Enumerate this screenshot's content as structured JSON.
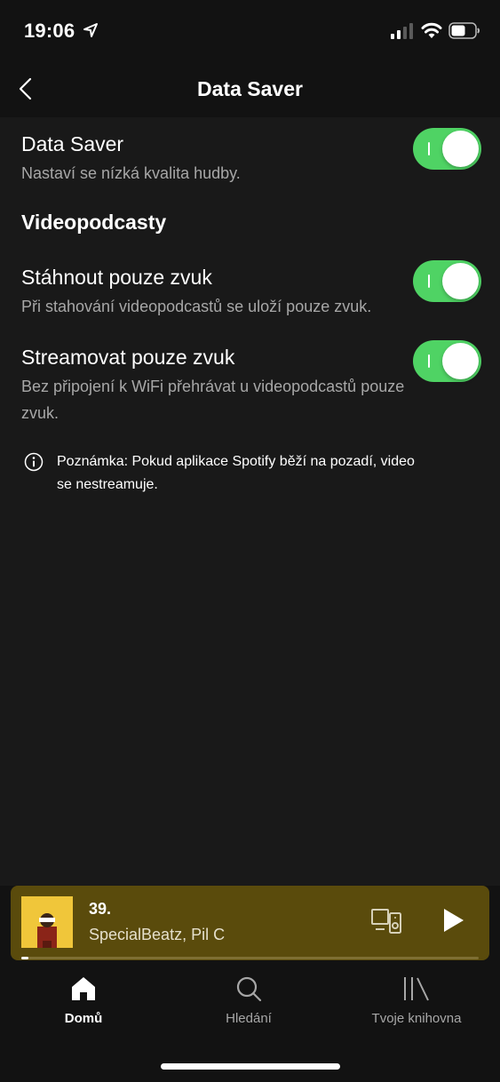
{
  "status_bar": {
    "time": "19:06"
  },
  "nav": {
    "title": "Data Saver"
  },
  "settings": {
    "data_saver": {
      "title": "Data Saver",
      "description": "Nastaví se nízká kvalita hudby.",
      "enabled": true
    },
    "section_heading": "Videopodcasty",
    "audio_only_download": {
      "title": "Stáhnout pouze zvuk",
      "description": "Při stahování videopodcastů se uloží pouze zvuk.",
      "enabled": true
    },
    "audio_only_stream": {
      "title": "Streamovat pouze zvuk",
      "description": "Bez připojení k WiFi přehrávat u videopodcastů pouze zvuk.",
      "enabled": true
    },
    "note": "Poznámka: Pokud aplikace Spotify běží na pozadí, video se nestreamuje."
  },
  "player": {
    "title": "39.",
    "artist": "SpecialBeatz, Pil C",
    "progress": 0.015
  },
  "tabs": [
    {
      "label": "Domů",
      "icon": "home-icon",
      "active": true
    },
    {
      "label": "Hledání",
      "icon": "search-icon",
      "active": false
    },
    {
      "label": "Tvoje knihovna",
      "icon": "library-icon",
      "active": false
    }
  ],
  "colors": {
    "accent": "#4fd364",
    "background": "#121212",
    "content_bg": "#191919",
    "player_bg": "#5a4b0c",
    "secondary_text": "#a7a7a7"
  }
}
